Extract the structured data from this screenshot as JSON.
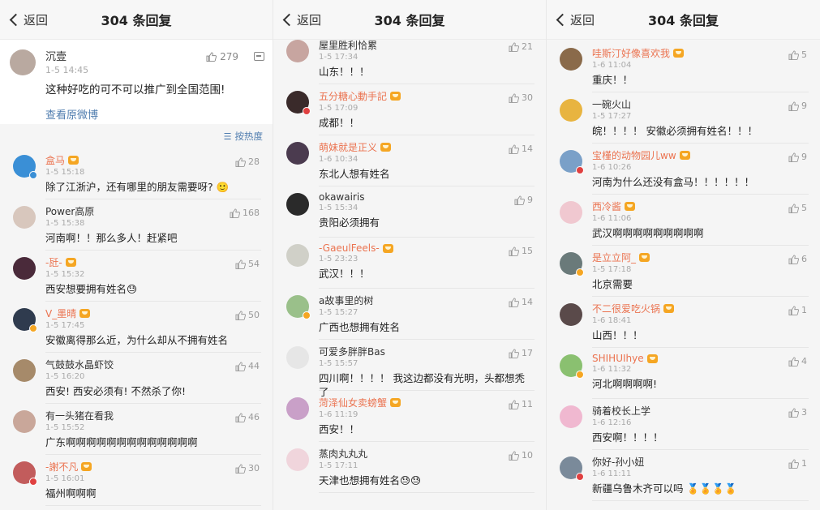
{
  "header": {
    "back_label": "返回",
    "title": "304 条回复"
  },
  "original": {
    "name": "沉壹",
    "time": "1-5 14:45",
    "likes": "279",
    "text": "这种好吃的可不可以推广到全国范围!",
    "link": "查看原微博",
    "avatar_color": "#b9a9a0"
  },
  "sort_label": "按热度",
  "panel1": [
    {
      "name": "盒马",
      "time": "1-5 15:18",
      "text": "除了江浙沪，还有哪里的朋友需要呀? 🙂",
      "likes": "28",
      "orange": true,
      "vip": true,
      "avatar_color": "#3a8fd6",
      "badge": "#3a8fd6"
    },
    {
      "name": "Power高原",
      "time": "1-5 15:38",
      "text": "河南啊！！那么多人！赶紧吧",
      "likes": "168",
      "orange": false,
      "vip": false,
      "avatar_color": "#d8c7bd",
      "badge": ""
    },
    {
      "name": "-瓩-",
      "time": "1-5 15:32",
      "text": "西安想要拥有姓名😓",
      "likes": "54",
      "orange": true,
      "vip": true,
      "avatar_color": "#4a2a3a",
      "badge": ""
    },
    {
      "name": "V_墨晴",
      "time": "1-5 17:45",
      "text": "安徽离得那么近，为什么却从不拥有姓名",
      "likes": "50",
      "orange": true,
      "vip": true,
      "avatar_color": "#2f3b4e",
      "badge": "#f5a623"
    },
    {
      "name": "气鼓鼓水晶虾饺",
      "time": "1-5 16:20",
      "text": "西安! 西安必须有! 不然杀了你!",
      "likes": "44",
      "orange": false,
      "vip": false,
      "avatar_color": "#a68a6a",
      "badge": ""
    },
    {
      "name": "有一头猪在看我",
      "time": "1-5 15:52",
      "text": "广东啊啊啊啊啊啊啊啊啊啊啊啊啊",
      "likes": "46",
      "orange": false,
      "vip": false,
      "avatar_color": "#c9a79a",
      "badge": ""
    },
    {
      "name": "-謝不凡",
      "time": "1-5 16:01",
      "text": "福州啊啊啊",
      "likes": "30",
      "orange": true,
      "vip": true,
      "avatar_color": "#c25c5c",
      "badge": "#e04040"
    }
  ],
  "panel2": [
    {
      "name": "屋里胜利恰累",
      "time": "1-5 17:34",
      "text": "山东！！！",
      "likes": "21",
      "orange": false,
      "vip": false,
      "avatar_color": "#c7a5a0",
      "badge": ""
    },
    {
      "name": "五分糖心動手記",
      "time": "1-5 17:09",
      "text": "成都！！",
      "likes": "30",
      "orange": true,
      "vip": true,
      "avatar_color": "#3a2a2a",
      "badge": "#e04040"
    },
    {
      "name": "萌妹就是正义",
      "time": "1-6 10:34",
      "text": "东北人想有姓名",
      "likes": "14",
      "orange": true,
      "vip": true,
      "avatar_color": "#4b3b4f",
      "badge": ""
    },
    {
      "name": "okawairis",
      "time": "1-5 15:34",
      "text": "贵阳必须拥有",
      "likes": "9",
      "orange": false,
      "vip": false,
      "avatar_color": "#2a2a2a",
      "badge": ""
    },
    {
      "name": "-GaeulFeels-",
      "time": "1-5 23:23",
      "text": "武汉！！！",
      "likes": "15",
      "orange": true,
      "vip": true,
      "avatar_color": "#d0d0c8",
      "badge": ""
    },
    {
      "name": "a故事里的树",
      "time": "1-5 15:27",
      "text": "广西也想拥有姓名",
      "likes": "14",
      "orange": false,
      "vip": false,
      "avatar_color": "#9ac08a",
      "badge": "#f5a623"
    },
    {
      "name": "可爱多胖胖Bas",
      "time": "1-5 15:57",
      "text": "四川啊！！！！ 我这边都没有光明，头都想秃了",
      "likes": "17",
      "orange": false,
      "vip": false,
      "avatar_color": "#e6e6e6",
      "badge": ""
    },
    {
      "name": "菏泽仙女卖螃蟹",
      "time": "1-6 11:19",
      "text": "西安！！",
      "likes": "11",
      "orange": true,
      "vip": true,
      "avatar_color": "#c9a0c8",
      "badge": ""
    },
    {
      "name": "蒸肉丸丸丸",
      "time": "1-5 17:11",
      "text": "天津也想拥有姓名😓😓",
      "likes": "10",
      "orange": false,
      "vip": false,
      "avatar_color": "#f0d5dc",
      "badge": ""
    }
  ],
  "panel3": [
    {
      "name": "哇斯汀好像喜欢我",
      "time": "1-6 11:04",
      "text": "重庆！！",
      "likes": "5",
      "orange": true,
      "vip": true,
      "avatar_color": "#8a6a4a",
      "badge": ""
    },
    {
      "name": "一碗火山",
      "time": "1-5 17:27",
      "text": "皖！！！！ 安徽必须拥有姓名！！！",
      "likes": "9",
      "orange": false,
      "vip": false,
      "avatar_color": "#e8b440",
      "badge": ""
    },
    {
      "name": "宝槿的动物园儿ww",
      "time": "1-6 10:26",
      "text": "河南为什么还没有盒马！！！！！！",
      "likes": "9",
      "orange": true,
      "vip": true,
      "avatar_color": "#7aa0c8",
      "badge": "#e04040"
    },
    {
      "name": "西冷酱",
      "time": "1-6 11:06",
      "text": "武汉啊啊啊啊啊啊啊啊啊",
      "likes": "5",
      "orange": true,
      "vip": true,
      "avatar_color": "#f0c8d0",
      "badge": ""
    },
    {
      "name": "是立立阿_",
      "time": "1-5 17:18",
      "text": "北京需要",
      "likes": "6",
      "orange": true,
      "vip": true,
      "avatar_color": "#6a7a7a",
      "badge": "#f5a623"
    },
    {
      "name": "不二很爱吃火锅",
      "time": "1-6 18:41",
      "text": "山西！！！",
      "likes": "1",
      "orange": true,
      "vip": true,
      "avatar_color": "#5a4a4a",
      "badge": ""
    },
    {
      "name": "SHIHUIhye",
      "time": "1-6 11:32",
      "text": "河北啊啊啊啊!",
      "likes": "4",
      "orange": true,
      "vip": true,
      "avatar_color": "#8ac070",
      "badge": "#f5a623"
    },
    {
      "name": "骑着校长上学",
      "time": "1-6 12:16",
      "text": "西安啊！！！！",
      "likes": "3",
      "orange": false,
      "vip": false,
      "avatar_color": "#f0b8d0",
      "badge": ""
    },
    {
      "name": "你好-孙小妞",
      "time": "1-6 11:11",
      "text": "新疆乌鲁木齐可以吗 🏅🏅🏅🏅",
      "likes": "1",
      "orange": false,
      "vip": false,
      "avatar_color": "#7a8a9a",
      "badge": "#e04040"
    }
  ]
}
